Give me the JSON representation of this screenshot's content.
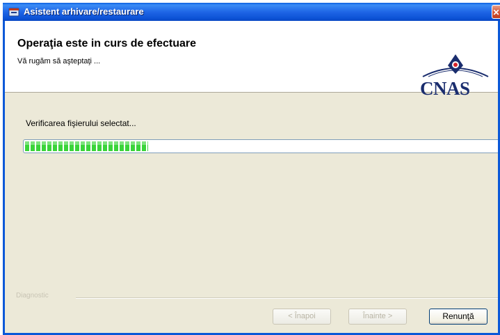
{
  "window": {
    "title": "Asistent arhivare/restaurare",
    "close_symbol": "✕",
    "icon": "archive-app-icon"
  },
  "header": {
    "title": "Operaţia este in curs de efectuare",
    "subtitle": "Vă rugăm să aşteptaţi ...",
    "logo_text": "CNAS"
  },
  "progress": {
    "label": "Verificarea fişierului selectat...",
    "fraction": 0.26,
    "color": "#3ad43a"
  },
  "footer": {
    "group_label": "Diagnostic"
  },
  "buttons": {
    "back": "< Înapoi",
    "next": "Înainte >",
    "cancel": "Renunţă"
  },
  "colors": {
    "titlebar": "#0a5fe0",
    "dialog_bg": "#ece9d8",
    "brand": "#1a2d6e",
    "logo_accent": "#d8232a"
  }
}
